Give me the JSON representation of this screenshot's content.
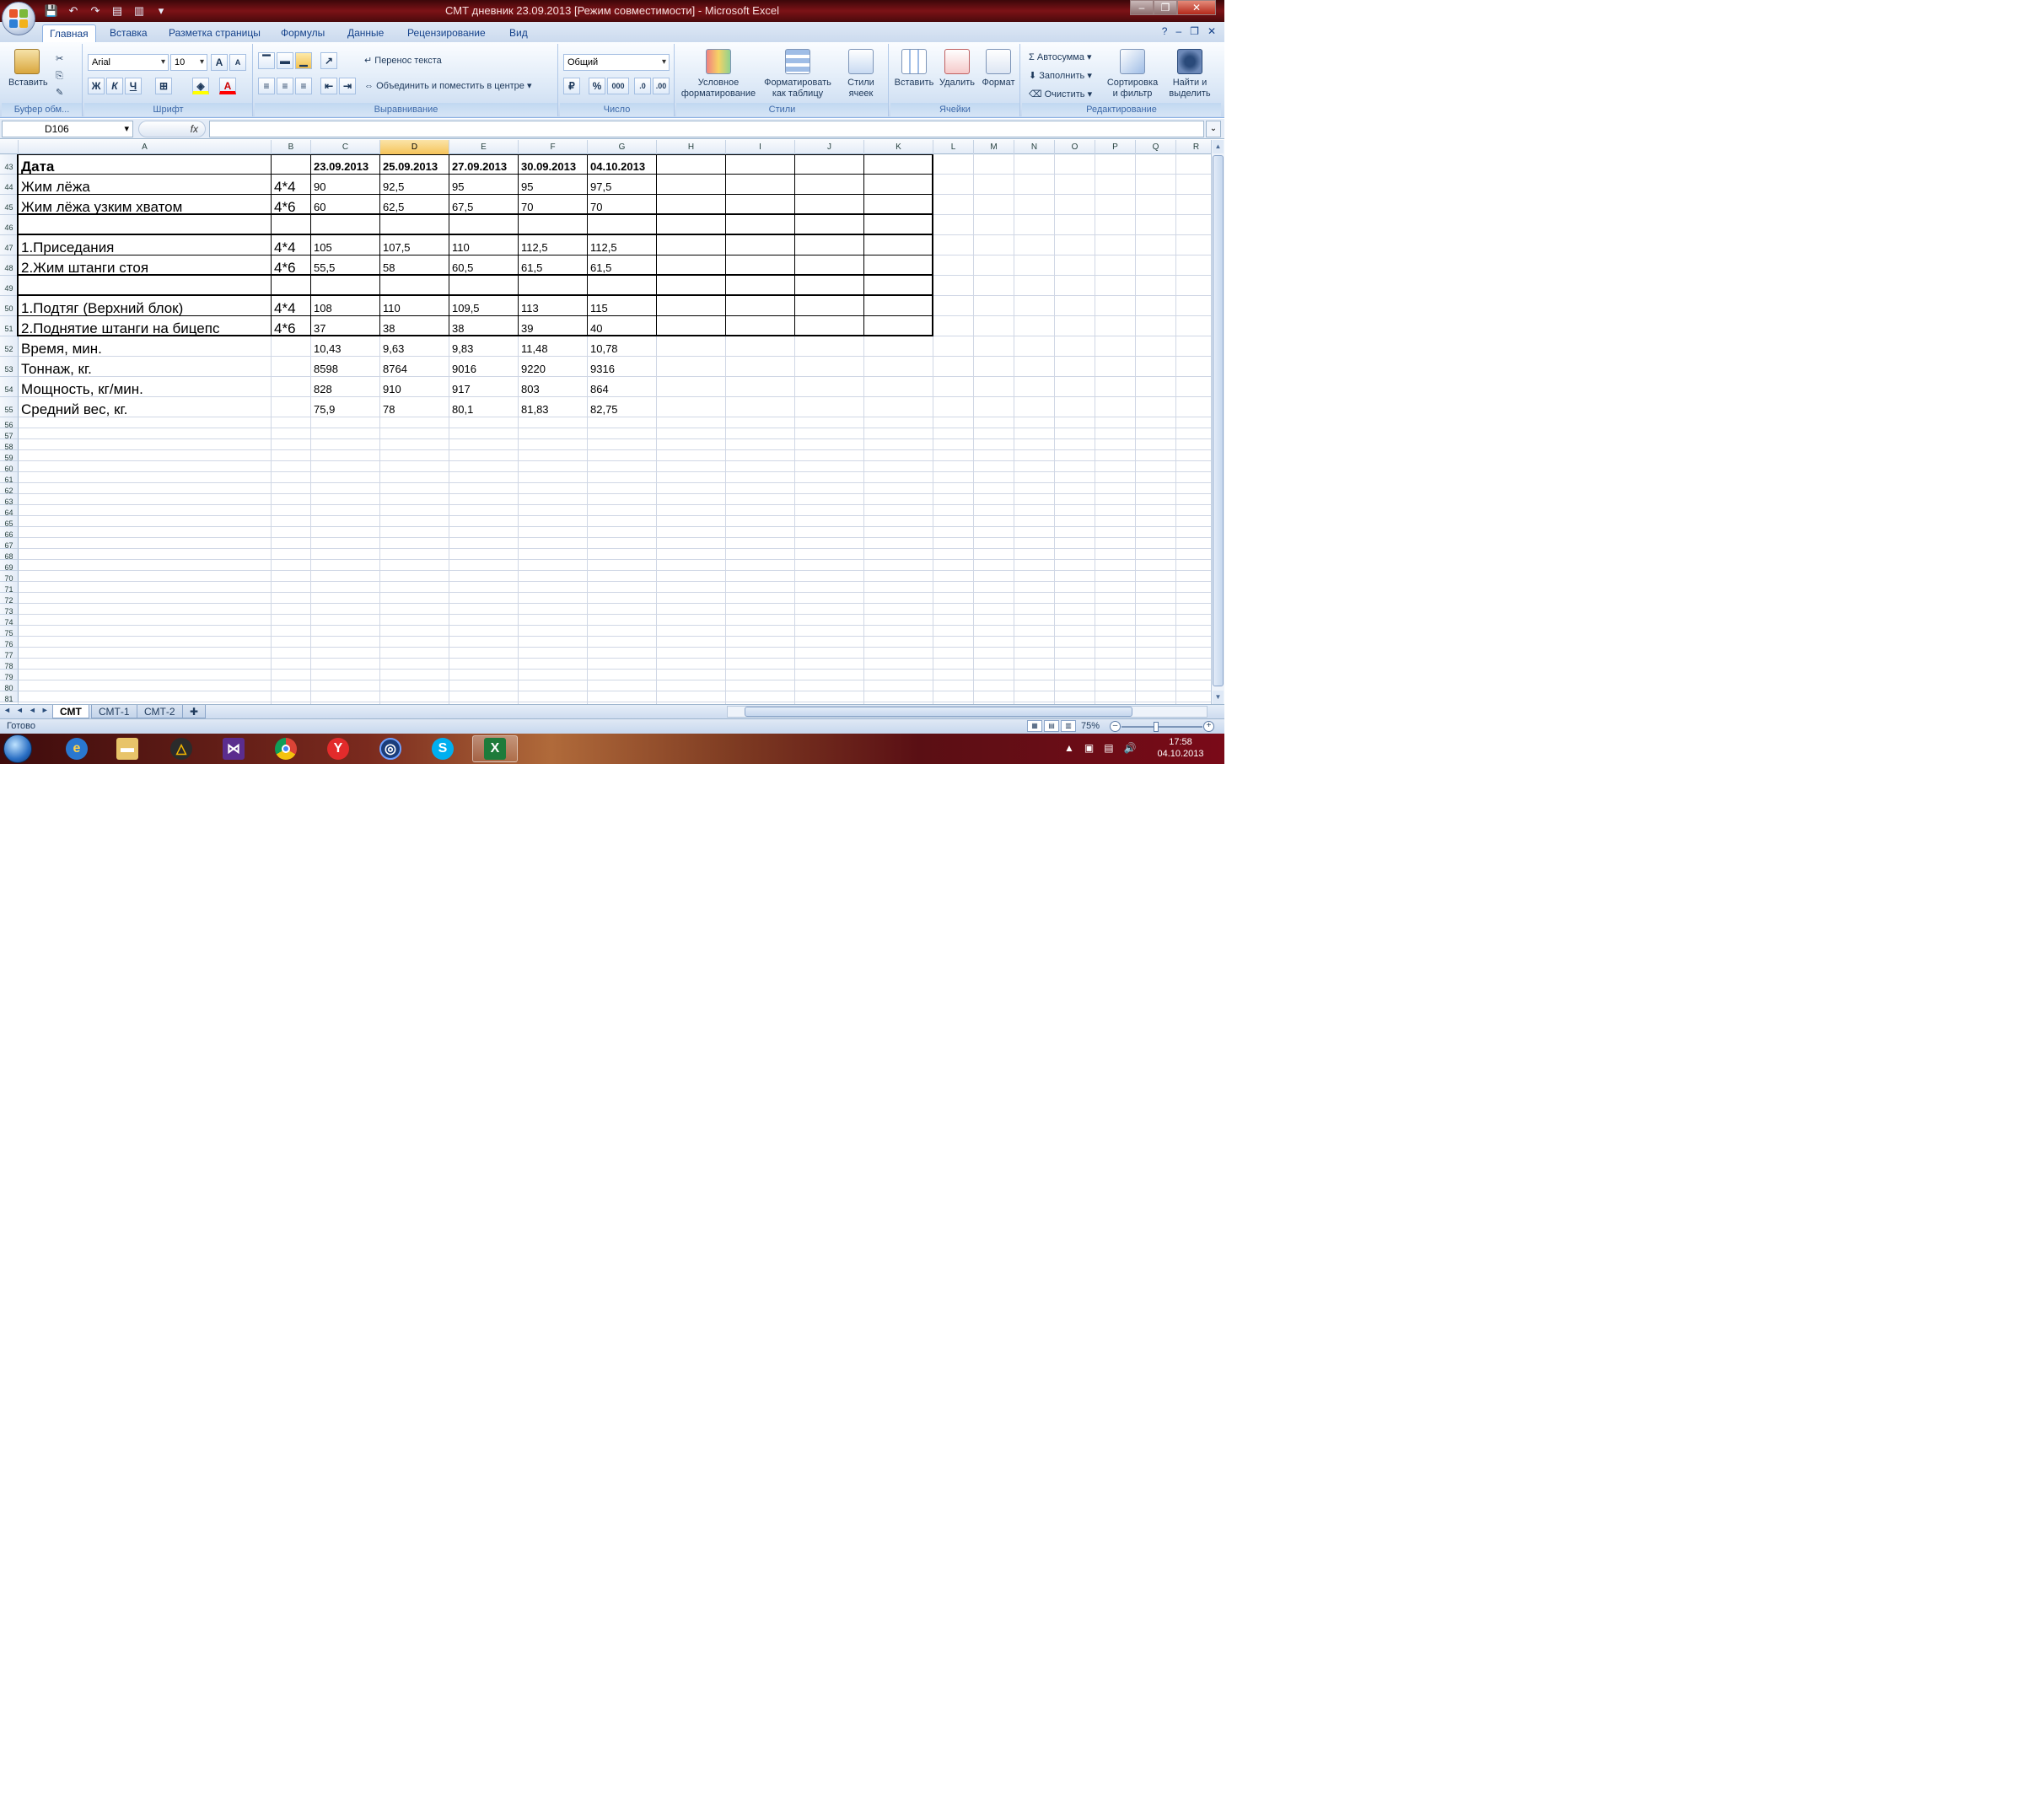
{
  "window": {
    "title": "СМТ дневник 23.09.2013  [Режим совместимости] - Microsoft Excel"
  },
  "ribbon": {
    "tabs": [
      "Главная",
      "Вставка",
      "Разметка страницы",
      "Формулы",
      "Данные",
      "Рецензирование",
      "Вид"
    ],
    "active_tab": "Главная",
    "groups": {
      "clipboard": "Буфер обм...",
      "font": "Шрифт",
      "alignment": "Выравнивание",
      "number": "Число",
      "styles": "Стили",
      "cells": "Ячейки",
      "editing": "Редактирование"
    },
    "paste_label": "Вставить",
    "font_name": "Arial",
    "font_size": "10",
    "bold": "Ж",
    "italic": "К",
    "underline": "Ч",
    "wrap_text": "Перенос текста",
    "merge_center": "Объединить и поместить в центре",
    "number_format": "Общий",
    "percent": "%",
    "thousands": "000",
    "cond_format_1": "Условное",
    "cond_format_2": "форматирование",
    "format_table_1": "Форматировать",
    "format_table_2": "как таблицу",
    "cell_styles_1": "Стили",
    "cell_styles_2": "ячеек",
    "insert": "Вставить",
    "delete": "Удалить",
    "format": "Формат",
    "autosum": "Автосумма",
    "fill": "Заполнить",
    "clear": "Очистить",
    "sort_1": "Сортировка",
    "sort_2": "и фильтр",
    "find_1": "Найти и",
    "find_2": "выделить"
  },
  "formula_bar": {
    "name_box": "D106",
    "fx": "fx",
    "value": ""
  },
  "columns": [
    "A",
    "B",
    "C",
    "D",
    "E",
    "F",
    "G",
    "H",
    "I",
    "J",
    "K",
    "L",
    "M",
    "N",
    "O",
    "P",
    "Q",
    "R"
  ],
  "selected_column": "D",
  "first_row": 43,
  "last_row": 81,
  "sheet": {
    "header": {
      "label": "Дата",
      "dates": [
        "23.09.2013",
        "25.09.2013",
        "27.09.2013",
        "30.09.2013",
        "04.10.2013"
      ]
    },
    "exercise_rows": [
      {
        "row": 44,
        "name": "Жим лёжа",
        "sets": "4*4",
        "values": [
          "90",
          "92,5",
          "95",
          "95",
          "97,5"
        ]
      },
      {
        "row": 45,
        "name": "Жим лёжа узким хватом",
        "sets": "4*6",
        "values": [
          "60",
          "62,5",
          "67,5",
          "70",
          "70"
        ]
      },
      {
        "row": 47,
        "name": "1.Приседания",
        "sets": "4*4",
        "values": [
          "105",
          "107,5",
          "110",
          "112,5",
          "112,5"
        ]
      },
      {
        "row": 48,
        "name": "2.Жим штанги стоя",
        "sets": "4*6",
        "values": [
          "55,5",
          "58",
          "60,5",
          "61,5",
          "61,5"
        ]
      },
      {
        "row": 50,
        "name": "1.Подтяг (Верхний блок)",
        "sets": "4*4",
        "values": [
          "108",
          "110",
          "109,5",
          "113",
          "115"
        ]
      },
      {
        "row": 51,
        "name": "2.Поднятие штанги на бицепс",
        "sets": "4*6",
        "values": [
          "37",
          "38",
          "38",
          "39",
          "40"
        ]
      }
    ],
    "stat_rows": [
      {
        "row": 52,
        "name": "Время, мин.",
        "values": [
          "10,43",
          "9,63",
          "9,83",
          "11,48",
          "10,78"
        ]
      },
      {
        "row": 53,
        "name": "Тоннаж, кг.",
        "values": [
          "8598",
          "8764",
          "9016",
          "9220",
          "9316"
        ]
      },
      {
        "row": 54,
        "name": "Мощность, кг/мин.",
        "values": [
          "828",
          "910",
          "917",
          "803",
          "864"
        ]
      },
      {
        "row": 55,
        "name": "Средний вес, кг.",
        "values": [
          "75,9",
          "78",
          "80,1",
          "81,83",
          "82,75"
        ]
      }
    ]
  },
  "sheet_tabs": [
    "СМТ",
    "СМТ-1",
    "СМТ-2"
  ],
  "active_sheet": "СМТ",
  "status": {
    "ready": "Готово",
    "zoom": "75%"
  },
  "taskbar": {
    "time": "17:58",
    "date": "04.10.2013"
  }
}
